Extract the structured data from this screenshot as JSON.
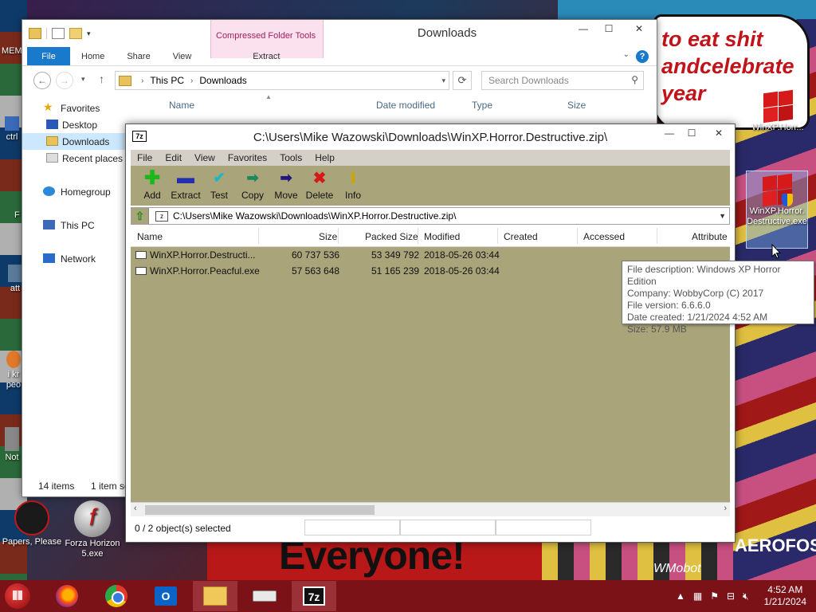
{
  "desktop": {
    "speech_text": [
      "to eat shit",
      "andcelebrate",
      "year"
    ],
    "banner_text": "Everyone!",
    "corner_text": "AEROFOS",
    "watermark_text": "WMobot",
    "icons": {
      "winxp_top": "WinXP.Horr...",
      "winxp_selected": "WinXP.Horror.Destructive.exe",
      "papers": "Papers, Please",
      "forza": "Forza Horizon 5.exe",
      "left_partial_1": "MEM",
      "left_partial_2": "ctrl",
      "left_partial_3": "F",
      "left_partial_4": "att",
      "left_partial_5": "i kr peo",
      "left_partial_6": "Not"
    }
  },
  "explorer": {
    "title": "Downloads",
    "context_tab": "Compressed Folder Tools",
    "tabs": [
      "File",
      "Home",
      "Share",
      "View"
    ],
    "context_subtab": "Extract",
    "address": [
      "This PC",
      "Downloads"
    ],
    "search_placeholder": "Search Downloads",
    "columns": [
      "Name",
      "Date modified",
      "Type",
      "Size"
    ],
    "nav": {
      "favorites": "Favorites",
      "desktop": "Desktop",
      "downloads": "Downloads",
      "recent": "Recent places",
      "homegroup": "Homegroup",
      "thispc": "This PC",
      "network": "Network"
    },
    "status_items": "14 items",
    "status_selected": "1 item se"
  },
  "sevenzip": {
    "title": "C:\\Users\\Mike Wazowski\\Downloads\\WinXP.Horror.Destructive.zip\\",
    "logo": "7z",
    "menu": [
      "File",
      "Edit",
      "View",
      "Favorites",
      "Tools",
      "Help"
    ],
    "toolbar": [
      {
        "label": "Add",
        "icon": "plus-icon"
      },
      {
        "label": "Extract",
        "icon": "minus-icon"
      },
      {
        "label": "Test",
        "icon": "check-icon"
      },
      {
        "label": "Copy",
        "icon": "arrow-right-icon"
      },
      {
        "label": "Move",
        "icon": "arrow-right-icon"
      },
      {
        "label": "Delete",
        "icon": "x-icon"
      },
      {
        "label": "Info",
        "icon": "info-icon"
      }
    ],
    "path": "C:\\Users\\Mike Wazowski\\Downloads\\WinXP.Horror.Destructive.zip\\",
    "columns": [
      "Name",
      "Size",
      "Packed Size",
      "Modified",
      "Created",
      "Accessed",
      "Attribute"
    ],
    "rows": [
      {
        "name": "WinXP.Horror.Destructi...",
        "size": "60 737 536",
        "packed": "53 349 792",
        "modified": "2018-05-26 03:44"
      },
      {
        "name": "WinXP.Horror.Peacful.exe",
        "size": "57 563 648",
        "packed": "51 165 239",
        "modified": "2018-05-26 03:44"
      }
    ],
    "status": "0 / 2 object(s) selected"
  },
  "tooltip": {
    "lines": [
      "File description: Windows XP Horror Edition",
      "Company: WobbyCorp (C) 2017",
      "File version: 6.6.6.0",
      "Date created: 1/21/2024 4:52 AM",
      "Size: 57.9 MB"
    ]
  },
  "taskbar": {
    "time": "4:52 AM",
    "date": "1/21/2024",
    "outlook_letter": "O",
    "sevenzip_label": "7z"
  },
  "colors": {
    "taskbar": "#7a1218",
    "toolbar_7z": "#a9a47a",
    "explorer_file_tab": "#1979ca",
    "context_tab": "#fbe0ee"
  }
}
